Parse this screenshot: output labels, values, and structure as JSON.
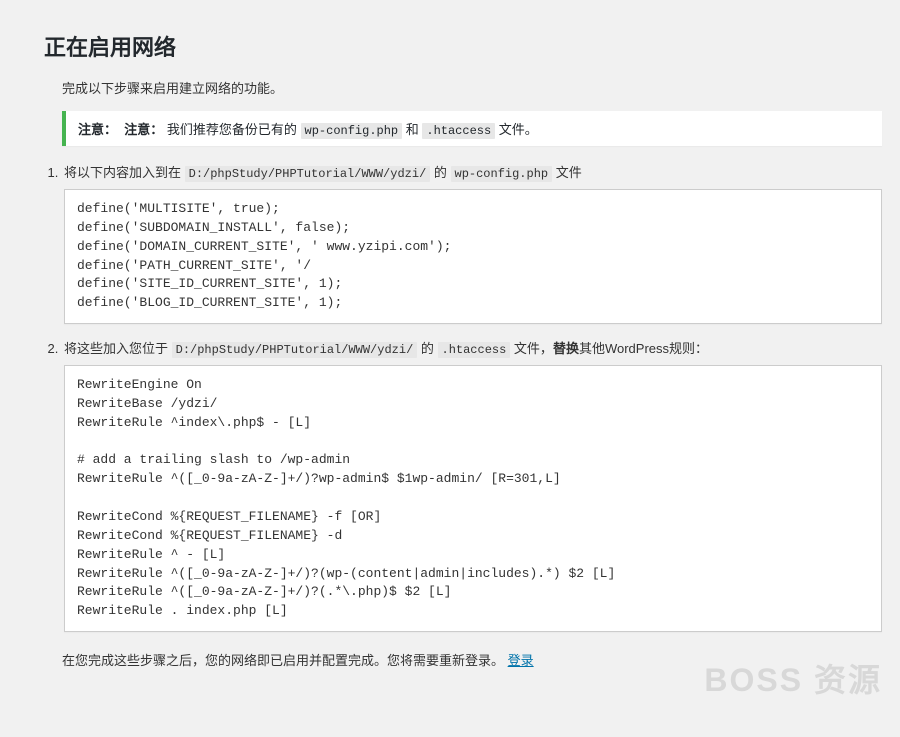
{
  "heading": "正在启用网络",
  "intro": "完成以下步骤来启用建立网络的功能。",
  "notice": {
    "label1": "注意：",
    "label2": "注意：",
    "text_before": "我们推荐您备份已有的 ",
    "code1": "wp-config.php",
    "mid": " 和 ",
    "code2": ".htaccess",
    "after": " 文件。"
  },
  "step1": {
    "prefix": "将以下内容加入到在 ",
    "path": "D:/phpStudy/PHPTutorial/WWW/ydzi/",
    "mid": " 的 ",
    "file": "wp-config.php",
    "suffix": " 文件",
    "code": "define('MULTISITE', true);\ndefine('SUBDOMAIN_INSTALL', false);\ndefine('DOMAIN_CURRENT_SITE', ' www.yzipi.com');\ndefine('PATH_CURRENT_SITE', '/\ndefine('SITE_ID_CURRENT_SITE', 1);\ndefine('BLOG_ID_CURRENT_SITE', 1);"
  },
  "step2": {
    "prefix": "将这些加入您位于 ",
    "path": "D:/phpStudy/PHPTutorial/WWW/ydzi/",
    "mid": " 的 ",
    "file": ".htaccess",
    "after_file": " 文件，",
    "bold": "替换",
    "rest": "其他WordPress规则：",
    "code": "RewriteEngine On\nRewriteBase /ydzi/\nRewriteRule ^index\\.php$ - [L]\n\n# add a trailing slash to /wp-admin\nRewriteRule ^([_0-9a-zA-Z-]+/)?wp-admin$ $1wp-admin/ [R=301,L]\n\nRewriteCond %{REQUEST_FILENAME} -f [OR]\nRewriteCond %{REQUEST_FILENAME} -d\nRewriteRule ^ - [L]\nRewriteRule ^([_0-9a-zA-Z-]+/)?(wp-(content|admin|includes).*) $2 [L]\nRewriteRule ^([_0-9a-zA-Z-]+/)?(.*\\.php)$ $2 [L]\nRewriteRule . index.php [L]"
  },
  "footer": {
    "text": "在您完成这些步骤之后，您的网络即已启用并配置完成。您将需要重新登录。 ",
    "link": "登录"
  },
  "watermark": "BOSS 资源"
}
